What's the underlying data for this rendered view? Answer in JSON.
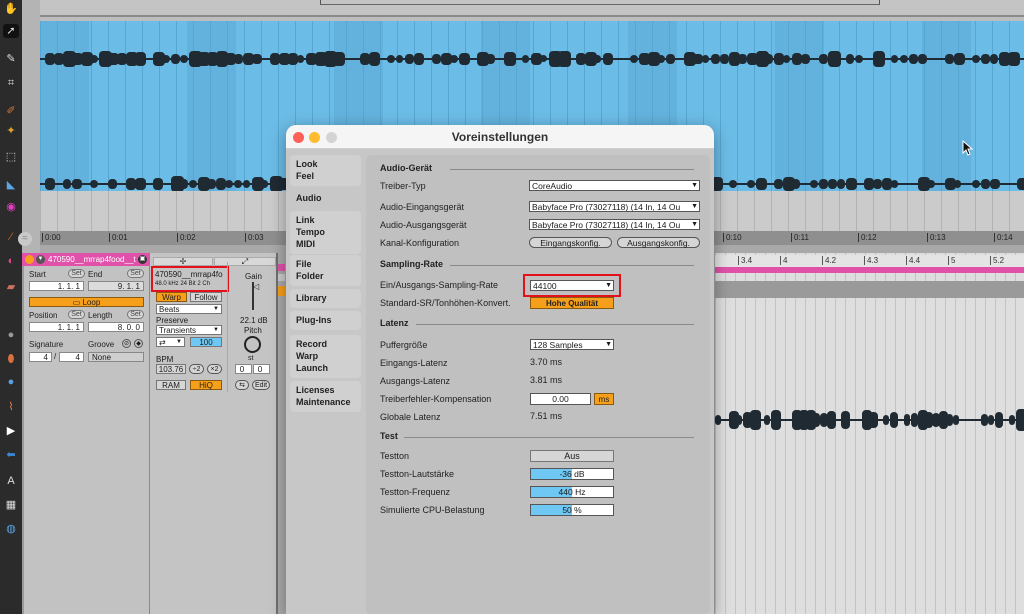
{
  "toolstrip": {
    "icons": [
      "hand-icon",
      "pointer-icon",
      "pencil-icon",
      "crop-icon",
      "brush-icon",
      "wand-icon",
      "marquee-icon",
      "speaker-icon",
      "color-wheel-icon",
      "eyedropper-icon",
      "magnet-icon",
      "eraser-icon",
      "bubble-icon",
      "bandage-icon",
      "play-icon",
      "arrow-icon",
      "text-icon",
      "grid-icon",
      "globe-icon"
    ]
  },
  "arrangement": {
    "time_ticks": [
      "0:00",
      "0:01",
      "0:02",
      "0:03",
      "0:10",
      "0:11",
      "0:12",
      "0:13",
      "0:14"
    ],
    "beat_ticks": [
      "3.4",
      "4",
      "4.2",
      "4.3",
      "4.4",
      "5",
      "5.2"
    ],
    "wave_color": "#6bbce6"
  },
  "clip": {
    "name": "470590__mrrap4food__t",
    "start_label": "Start",
    "end_label": "End",
    "set_label": "Set",
    "start_value": "1.   1.   1",
    "end_value": "9.   1.   1",
    "loop_label": "Loop",
    "position_label": "Position",
    "length_label": "Length",
    "position_value": "1.   1.   1",
    "length_value": "8.   0.   0",
    "signature_label": "Signature",
    "groove_label": "Groove",
    "sig_num": "4",
    "sig_den": "4",
    "groove_value": "None",
    "accent_color": "#e052a9"
  },
  "sample": {
    "filename": "470590__mrrap4fo",
    "info": "48.0 kHz   24 Bit   2 Ch",
    "warp_label": "Warp",
    "follow_label": "Follow",
    "mode_value": "Beats",
    "preserve_label": "Preserve",
    "preserve_value": "Transients",
    "loop_mode_value": "⇄",
    "envelope_value": "100",
    "bpm_label": "BPM",
    "bpm_value": "103.76",
    "half_label": "÷2",
    "double_label": "×2",
    "ram_label": "RAM",
    "hiq_label": "HiQ",
    "gain_label": "Gain",
    "gain_value": "22.1 dB",
    "pitch_label": "Pitch",
    "pitch_unit": "st",
    "transpose_st": "0",
    "transpose_ct": "0",
    "edit_label": "Edit"
  },
  "dialog": {
    "title": "Voreinstellungen",
    "nav": [
      {
        "lines": [
          "Look",
          "Feel"
        ]
      },
      {
        "lines": [
          "Audio"
        ],
        "active": true
      },
      {
        "lines": [
          "Link",
          "Tempo",
          "MIDI"
        ]
      },
      {
        "lines": [
          "File",
          "Folder"
        ]
      },
      {
        "lines": [
          "Library"
        ]
      },
      {
        "lines": [
          "Plug-Ins"
        ]
      },
      {
        "lines": [
          "Record",
          "Warp",
          "Launch"
        ]
      },
      {
        "lines": [
          "Licenses",
          "Maintenance"
        ]
      }
    ],
    "audio_device": {
      "heading": "Audio-Gerät",
      "driver_label": "Treiber-Typ",
      "driver_value": "CoreAudio",
      "input_label": "Audio-Eingangsgerät",
      "input_value": "Babyface Pro (73027118) (14 In, 14 Ou",
      "output_label": "Audio-Ausgangsgerät",
      "output_value": "Babyface Pro (73027118) (14 In, 14 Ou",
      "channel_label": "Kanal-Konfiguration",
      "input_config": "Eingangskonfig.",
      "output_config": "Ausgangskonfig."
    },
    "sampling": {
      "heading": "Sampling-Rate",
      "rate_label": "Ein/Ausgangs-Sampling-Rate",
      "rate_value": "44100",
      "src_label": "Standard-SR/Tonhöhen-Konvert.",
      "src_value": "Hohe Qualität"
    },
    "latency": {
      "heading": "Latenz",
      "buffer_label": "Puffergröße",
      "buffer_value": "128 Samples",
      "in_label": "Eingangs-Latenz",
      "in_value": "3.70 ms",
      "out_label": "Ausgangs-Latenz",
      "out_value": "3.81 ms",
      "comp_label": "Treiberfehler-Kompensation",
      "comp_value": "0.00",
      "comp_unit": "ms",
      "global_label": "Globale Latenz",
      "global_value": "7.51 ms"
    },
    "test": {
      "heading": "Test",
      "tone_label": "Testton",
      "tone_value": "Aus",
      "volume_label": "Testton-Lautstärke",
      "volume_value": "-36 dB",
      "volume_fill": 0.5,
      "freq_label": "Testton-Frequenz",
      "freq_value": "440 Hz",
      "freq_fill": 0.5,
      "cpu_label": "Simulierte CPU-Belastung",
      "cpu_value": "50 %",
      "cpu_fill": 0.5
    }
  },
  "colors": {
    "orange": "#f59f1b",
    "highlight_red": "#e4101a",
    "slider_blue": "#6fc8f3"
  }
}
